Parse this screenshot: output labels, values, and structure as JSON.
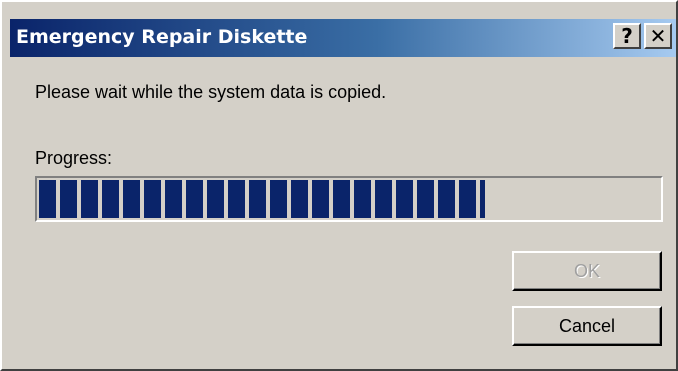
{
  "window": {
    "title": "Emergency Repair Diskette",
    "help_button_label": "?",
    "close_button_label": "✕"
  },
  "dialog": {
    "message": "Please wait while the system data is copied.",
    "progress_label": "Progress:",
    "progress_fraction": 0.72
  },
  "buttons": {
    "ok_label": "OK",
    "ok_enabled": false,
    "cancel_label": "Cancel"
  },
  "colors": {
    "title_bar_start": "#0a246a",
    "title_bar_end": "#a6caf0",
    "progress_block": "#0a246a",
    "dialog_face": "#d4d0c8"
  }
}
